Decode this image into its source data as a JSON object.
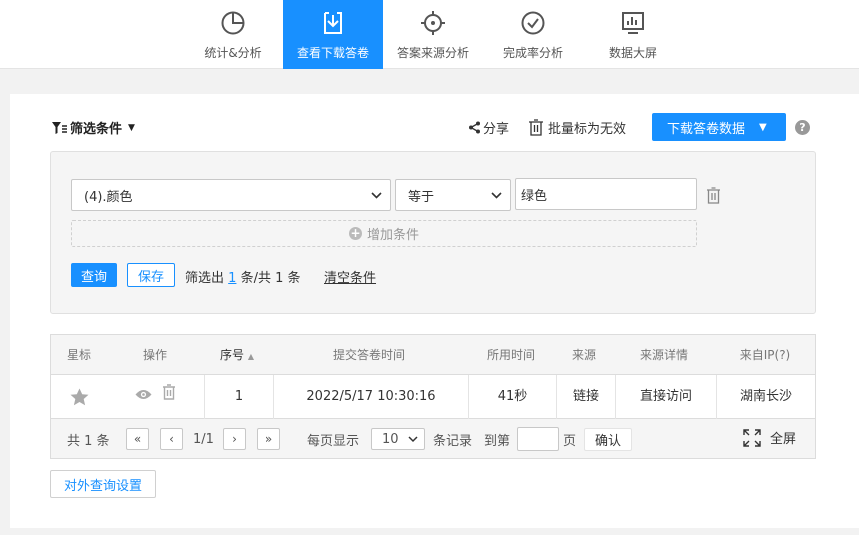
{
  "nav": {
    "items": [
      {
        "label": "统计&分析",
        "icon": "pie-chart-icon",
        "active": false
      },
      {
        "label": "查看下载答卷",
        "icon": "download-icon",
        "active": true
      },
      {
        "label": "答案来源分析",
        "icon": "crosshair-icon",
        "active": false
      },
      {
        "label": "完成率分析",
        "icon": "check-circle-icon",
        "active": false
      },
      {
        "label": "数据大屏",
        "icon": "monitor-chart-icon",
        "active": false
      }
    ]
  },
  "toolbar": {
    "filter_label": "筛选条件",
    "share_label": "分享",
    "batch_label": "批量标为无效",
    "download_label": "下载答卷数据",
    "help": "?"
  },
  "filter": {
    "field_value": "(4).颜色",
    "operator_value": "等于",
    "text_value": "绿色",
    "add_label": "增加条件",
    "query_label": "查询",
    "save_label": "保存",
    "result_prefix": "筛选出",
    "result_count": "1",
    "result_suffix": "条/共 1 条",
    "clear_label": "清空条件"
  },
  "table": {
    "headers": [
      "星标",
      "操作",
      "序号",
      "提交答卷时间",
      "所用时间",
      "来源",
      "来源详情",
      "来自IP(?)"
    ],
    "sort_indicator": "▲",
    "rows": [
      {
        "seq": "1",
        "time": "2022/5/17 10:30:16",
        "duration": "41秒",
        "source": "链接",
        "source_detail": "直接访问",
        "ip": "湖南长沙"
      }
    ]
  },
  "pager": {
    "total": "共 1 条",
    "page": "1/1",
    "per_page_label": "每页显示",
    "per_page_value": "10",
    "records_label": "条记录",
    "goto_label": "到第",
    "page_label": "页",
    "confirm_label": "确认",
    "fullscreen_label": "全屏"
  },
  "external_query_label": "对外查询设置",
  "colors": {
    "accent": "#1890ff"
  }
}
